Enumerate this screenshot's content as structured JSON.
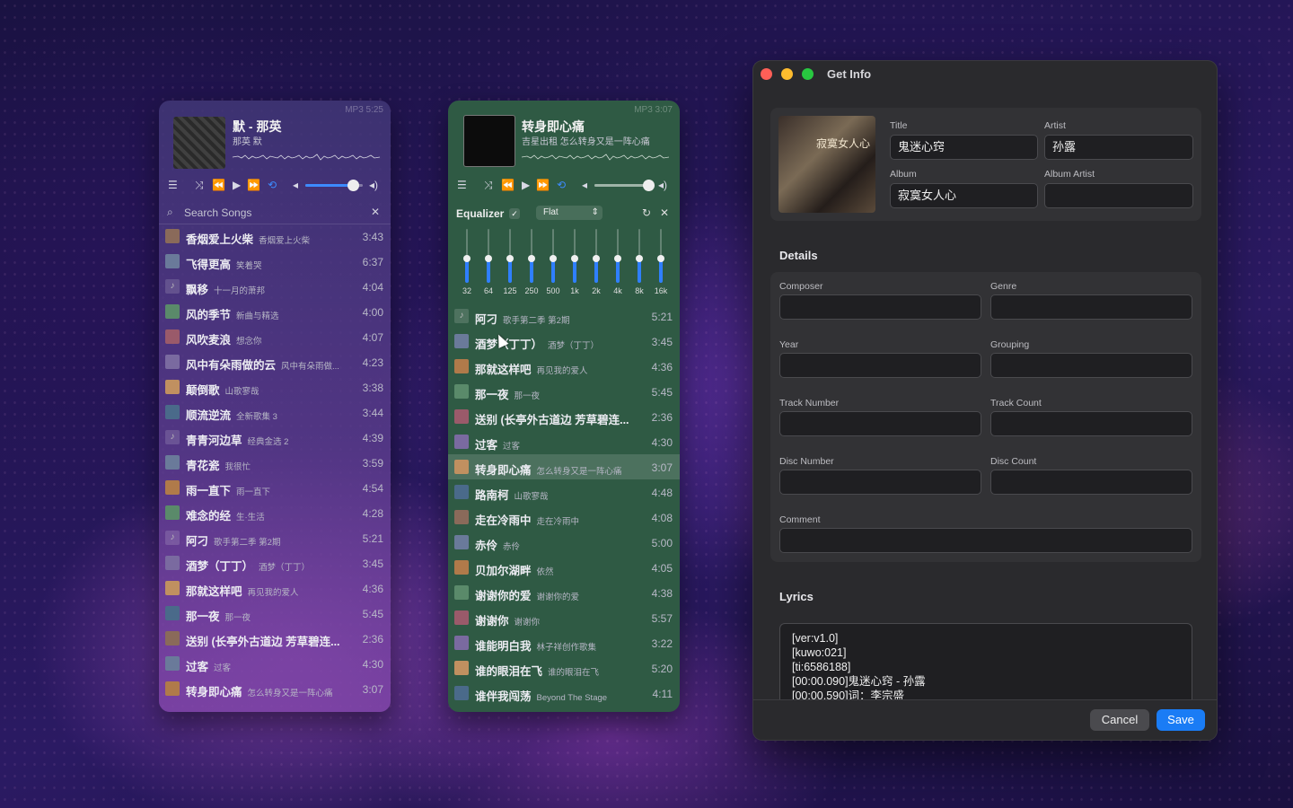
{
  "player1": {
    "badge": "MP3 5:25",
    "title": "默 - 那英",
    "subtitle": "那英 默",
    "search_placeholder": "Search Songs",
    "accent": "#3d8bff",
    "volume_level": 0.85,
    "songs": [
      {
        "title": "香烟爱上火柴",
        "album": "香烟爱上火柴",
        "duration": "3:43"
      },
      {
        "title": "飞得更高",
        "album": "笑着哭",
        "duration": "6:37"
      },
      {
        "title": "飘移",
        "album": "十一月的萧邦",
        "duration": "4:04"
      },
      {
        "title": "风的季节",
        "album": "新曲与精选",
        "duration": "4:00"
      },
      {
        "title": "风吹麦浪",
        "album": "想念你",
        "duration": "4:07"
      },
      {
        "title": "风中有朵雨做的云",
        "album": "风中有朵雨做...",
        "duration": "4:23"
      },
      {
        "title": "颠倒歌",
        "album": "山歌寥哉",
        "duration": "3:38"
      },
      {
        "title": "顺流逆流",
        "album": "全新歌集 3",
        "duration": "3:44"
      },
      {
        "title": "青青河边草",
        "album": "经典金选 2",
        "duration": "4:39"
      },
      {
        "title": "青花瓷",
        "album": "我很忙",
        "duration": "3:59"
      },
      {
        "title": "雨一直下",
        "album": "雨一直下",
        "duration": "4:54"
      },
      {
        "title": "难念的经",
        "album": "生·生活",
        "duration": "4:28"
      },
      {
        "title": "阿刁",
        "album": "歌手第二季 第2期",
        "duration": "5:21"
      },
      {
        "title": "酒梦（丁丁）",
        "album": "酒梦（丁丁）",
        "duration": "3:45"
      },
      {
        "title": "那就这样吧",
        "album": "再见我的爱人",
        "duration": "4:36"
      },
      {
        "title": "那一夜",
        "album": "那一夜",
        "duration": "5:45"
      },
      {
        "title": "送别 (长亭外古道边 芳草碧连...",
        "album": "",
        "duration": "2:36"
      },
      {
        "title": "过客",
        "album": "过客",
        "duration": "4:30"
      },
      {
        "title": "转身即心痛",
        "album": "怎么转身又是一阵心痛",
        "duration": "3:07"
      }
    ]
  },
  "player2": {
    "badge": "MP3 3:07",
    "title": "转身即心痛",
    "subtitle": "吉星出租 怎么转身又是一阵心痛",
    "volume_level": 0.95,
    "equalizer": {
      "label": "Equalizer",
      "enabled": "✓",
      "preset": "Flat",
      "bands": [
        {
          "label": "32",
          "gain": 0
        },
        {
          "label": "64",
          "gain": 0
        },
        {
          "label": "125",
          "gain": 0
        },
        {
          "label": "250",
          "gain": 0
        },
        {
          "label": "500",
          "gain": 0
        },
        {
          "label": "1k",
          "gain": 0
        },
        {
          "label": "2k",
          "gain": 0
        },
        {
          "label": "4k",
          "gain": 0
        },
        {
          "label": "8k",
          "gain": 0
        },
        {
          "label": "16k",
          "gain": 0
        }
      ]
    },
    "songs": [
      {
        "title": "阿刁",
        "album": "歌手第二季 第2期",
        "duration": "5:21"
      },
      {
        "title": "酒梦（丁丁）",
        "album": "酒梦（丁丁）",
        "duration": "3:45"
      },
      {
        "title": "那就这样吧",
        "album": "再见我的爱人",
        "duration": "4:36"
      },
      {
        "title": "那一夜",
        "album": "那一夜",
        "duration": "5:45"
      },
      {
        "title": "送别 (长亭外古道边 芳草碧连...",
        "album": "",
        "duration": "2:36"
      },
      {
        "title": "过客",
        "album": "过客",
        "duration": "4:30"
      },
      {
        "title": "转身即心痛",
        "album": "怎么转身又是一阵心痛",
        "duration": "3:07"
      },
      {
        "title": "路南柯",
        "album": "山歌寥哉",
        "duration": "4:48"
      },
      {
        "title": "走在冷雨中",
        "album": "走在冷雨中",
        "duration": "4:08"
      },
      {
        "title": "赤伶",
        "album": "赤伶",
        "duration": "5:00"
      },
      {
        "title": "贝加尔湖畔",
        "album": "依然",
        "duration": "4:05"
      },
      {
        "title": "谢谢你的爱",
        "album": "谢谢你的爱",
        "duration": "4:38"
      },
      {
        "title": "谢谢你",
        "album": "谢谢你",
        "duration": "5:57"
      },
      {
        "title": "谁能明白我",
        "album": "林子祥创作歌集",
        "duration": "3:22"
      },
      {
        "title": "谁的眼泪在飞",
        "album": "谁的眼泪在飞",
        "duration": "5:20"
      },
      {
        "title": "谁伴我闯荡",
        "album": "Beyond The Stage",
        "duration": "4:11"
      }
    ]
  },
  "getinfo": {
    "window_title": "Get Info",
    "album_art_caption": "寂寞女人心",
    "labels": {
      "title": "Title",
      "artist": "Artist",
      "album": "Album",
      "album_artist": "Album Artist",
      "details": "Details",
      "composer": "Composer",
      "genre": "Genre",
      "year": "Year",
      "grouping": "Grouping",
      "track_number": "Track Number",
      "track_count": "Track Count",
      "disc_number": "Disc Number",
      "disc_count": "Disc Count",
      "comment": "Comment",
      "lyrics": "Lyrics"
    },
    "values": {
      "title": "鬼迷心窍",
      "artist": "孙露",
      "album": "寂寞女人心",
      "album_artist": "",
      "composer": "",
      "genre": "",
      "year": "",
      "grouping": "",
      "track_number": "",
      "track_count": "",
      "disc_number": "",
      "disc_count": "",
      "comment": ""
    },
    "lyrics_lines": [
      "[ver:v1.0]",
      "[kuwo:021]",
      "[ti:6586188]",
      "[00:00.090]鬼迷心窍 - 孙露",
      "[00:00.590]词：李宗盛"
    ],
    "cancel_label": "Cancel",
    "save_label": "Save"
  }
}
